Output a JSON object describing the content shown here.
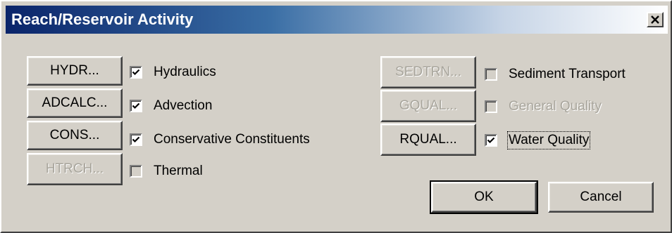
{
  "window": {
    "title": "Reach/Reservoir Activity",
    "close_icon": "close-icon"
  },
  "left_buttons": [
    {
      "label": "HYDR...",
      "enabled": true
    },
    {
      "label": "ADCALC...",
      "enabled": true
    },
    {
      "label": "CONS...",
      "enabled": true
    },
    {
      "label": "HTRCH...",
      "enabled": false
    }
  ],
  "left_checks": [
    {
      "label": "Hydraulics",
      "checked": true,
      "enabled": true
    },
    {
      "label": "Advection",
      "checked": true,
      "enabled": true
    },
    {
      "label": "Conservative Constituents",
      "checked": true,
      "enabled": true
    },
    {
      "label": "Thermal",
      "checked": false,
      "enabled": true
    }
  ],
  "right_buttons": [
    {
      "label": "SEDTRN...",
      "enabled": false
    },
    {
      "label": "GQUAL...",
      "enabled": false
    },
    {
      "label": "RQUAL...",
      "enabled": true
    }
  ],
  "right_checks": [
    {
      "label": "Sediment Transport",
      "checked": false,
      "enabled": true
    },
    {
      "label": "General Quality",
      "checked": false,
      "enabled": false
    },
    {
      "label": "Water Quality",
      "checked": true,
      "enabled": true,
      "focused": true
    }
  ],
  "footer": {
    "ok_label": "OK",
    "cancel_label": "Cancel"
  }
}
